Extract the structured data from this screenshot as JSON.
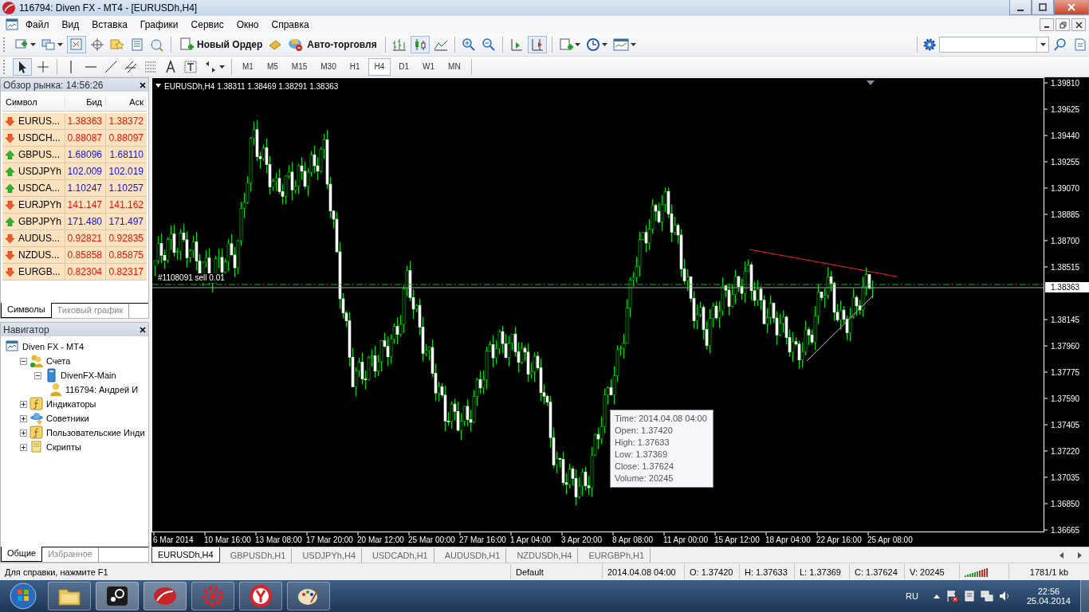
{
  "window": {
    "title": "116794: Diven FX - MT4 - [EURUSDh,H4]"
  },
  "menu": [
    "Файл",
    "Вид",
    "Вставка",
    "Графики",
    "Сервис",
    "Окно",
    "Справка"
  ],
  "toolbar": {
    "new_order": "Новый Ордер",
    "auto_trading": "Авто-торговля"
  },
  "timeframes": [
    {
      "label": "M1",
      "selected": false
    },
    {
      "label": "M5",
      "selected": false
    },
    {
      "label": "M15",
      "selected": false
    },
    {
      "label": "M30",
      "selected": false
    },
    {
      "label": "H1",
      "selected": false
    },
    {
      "label": "H4",
      "selected": true
    },
    {
      "label": "D1",
      "selected": false
    },
    {
      "label": "W1",
      "selected": false
    },
    {
      "label": "MN",
      "selected": false
    }
  ],
  "market_watch": {
    "title": "Обзор рынка: 14:56:26",
    "columns": [
      "Символ",
      "Бид",
      "Аск"
    ],
    "rows": [
      {
        "symbol": "EURUS...",
        "bid": "1.38363",
        "ask": "1.38372",
        "rising": false
      },
      {
        "symbol": "USDCH...",
        "bid": "0.88087",
        "ask": "0.88097",
        "rising": false
      },
      {
        "symbol": "GBPUS...",
        "bid": "1.68096",
        "ask": "1.68110",
        "rising": true
      },
      {
        "symbol": "USDJPYh",
        "bid": "102.009",
        "ask": "102.019",
        "rising": true
      },
      {
        "symbol": "USDCA...",
        "bid": "1.10247",
        "ask": "1.10257",
        "rising": true
      },
      {
        "symbol": "EURJPYh",
        "bid": "141.147",
        "ask": "141.162",
        "rising": false
      },
      {
        "symbol": "GBPJPYh",
        "bid": "171.480",
        "ask": "171.497",
        "rising": true
      },
      {
        "symbol": "AUDUS...",
        "bid": "0.92821",
        "ask": "0.92835",
        "rising": false
      },
      {
        "symbol": "NZDUS...",
        "bid": "0.85858",
        "ask": "0.85875",
        "rising": false
      },
      {
        "symbol": "EURGB...",
        "bid": "0.82304",
        "ask": "0.82317",
        "rising": false
      }
    ],
    "tabs": [
      {
        "label": "Символы",
        "selected": true
      },
      {
        "label": "Тиковый график",
        "selected": false
      }
    ]
  },
  "navigator": {
    "title": "Навигатор",
    "tree": [
      {
        "label": "Diven FX - MT4",
        "kind": "terminal",
        "children": [
          {
            "label": "Счета",
            "kind": "accounts",
            "expanded": true,
            "children": [
              {
                "label": "DivenFX-Main",
                "kind": "server",
                "expanded": true,
                "children": [
                  {
                    "label": "116794: Андрей И",
                    "kind": "account"
                  }
                ]
              }
            ]
          },
          {
            "label": "Индикаторы",
            "kind": "indicators",
            "expanded": false
          },
          {
            "label": "Советники",
            "kind": "experts",
            "expanded": false
          },
          {
            "label": "Пользовательские Инди",
            "kind": "custom",
            "expanded": false
          },
          {
            "label": "Скрипты",
            "kind": "scripts",
            "expanded": false
          }
        ]
      }
    ],
    "tabs": [
      {
        "label": "Общие",
        "selected": true
      },
      {
        "label": "Избранное",
        "selected": false
      }
    ]
  },
  "chart": {
    "header": "EURUSDh,H4  1.38311 1.38469 1.38291 1.38363",
    "order_label": "#1108091 sell 0.01",
    "current_price": "1.38363",
    "price_axis": [
      "1.39810",
      "1.39625",
      "1.39440",
      "1.39255",
      "1.39070",
      "1.38885",
      "1.38700",
      "1.38515",
      "1.38145",
      "1.37960",
      "1.37775",
      "1.37590",
      "1.37405",
      "1.37220",
      "1.37035",
      "1.36850",
      "1.36665"
    ],
    "time_axis": [
      "6 Mar 2014",
      "10 Mar 16:00",
      "13 Mar 08:00",
      "17 Mar 20:00",
      "20 Mar 12:00",
      "25 Mar 00:00",
      "27 Mar 16:00",
      "1 Apr 04:00",
      "3 Apr 20:00",
      "8 Apr 08:00",
      "11 Apr 00:00",
      "15 Apr 12:00",
      "18 Apr 04:00",
      "22 Apr 16:00",
      "25 Apr 08:00"
    ],
    "tooltip": [
      "Time: 2014.04.08 04:00",
      "Open: 1.37420",
      "High: 1.37633",
      "Low:  1.37369",
      "Close: 1.37624",
      "Volume: 20245"
    ]
  },
  "chart_tabs": [
    {
      "label": "EURUSDh,H4",
      "selected": true
    },
    {
      "label": "GBPUSDh,H1",
      "selected": false
    },
    {
      "label": "USDJPYh,H4",
      "selected": false
    },
    {
      "label": "USDCADh,H1",
      "selected": false
    },
    {
      "label": "AUDUSDh,H1",
      "selected": false
    },
    {
      "label": "NZDUSDh,H4",
      "selected": false
    },
    {
      "label": "EURGBPh,H1",
      "selected": false
    }
  ],
  "status_bar": {
    "help": "Для справки, нажмите F1",
    "profile": "Default",
    "time": "2014.04.08 04:00",
    "open": "O: 1.37420",
    "high": "H: 1.37633",
    "low": "L: 1.37369",
    "close": "C: 1.37624",
    "volume": "V: 20245",
    "traffic": "1781/1 kb"
  },
  "taskbar": {
    "language": "RU",
    "time": "22:56",
    "date": "25.04.2014"
  }
}
